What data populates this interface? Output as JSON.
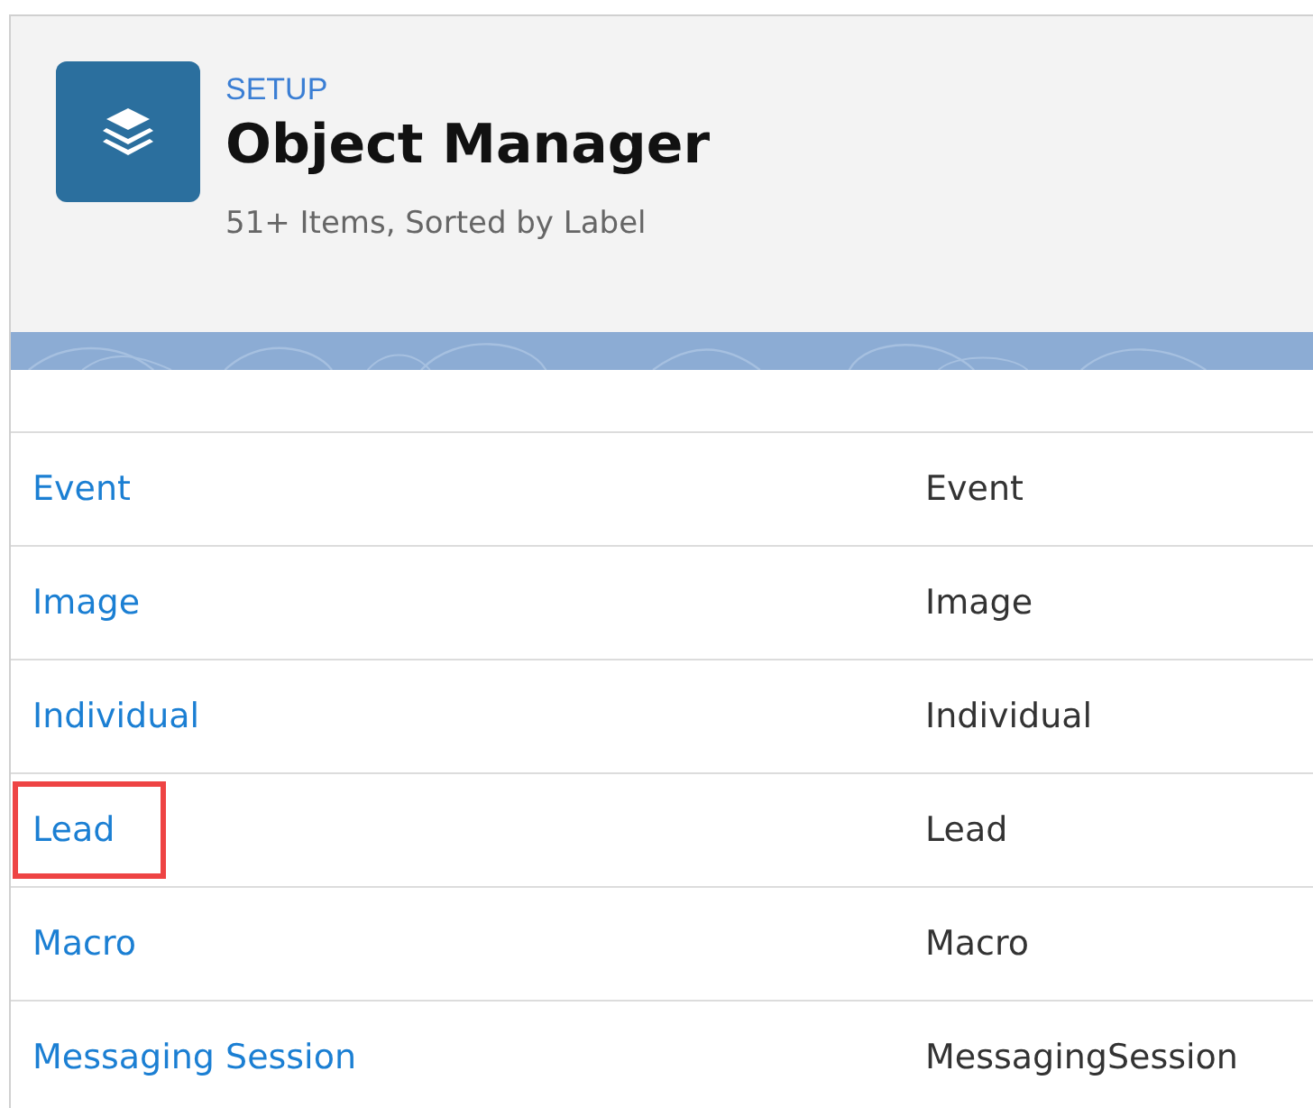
{
  "header": {
    "eyebrow": "SETUP",
    "title": "Object Manager",
    "subtitle": "51+ Items, Sorted by Label"
  },
  "rows": [
    {
      "label": "Event",
      "api_name": "Event",
      "highlighted": false
    },
    {
      "label": "Image",
      "api_name": "Image",
      "highlighted": false
    },
    {
      "label": "Individual",
      "api_name": "Individual",
      "highlighted": false
    },
    {
      "label": "Lead",
      "api_name": "Lead",
      "highlighted": true
    },
    {
      "label": "Macro",
      "api_name": "Macro",
      "highlighted": false
    },
    {
      "label": "Messaging Session",
      "api_name": "MessagingSession",
      "highlighted": false
    }
  ]
}
